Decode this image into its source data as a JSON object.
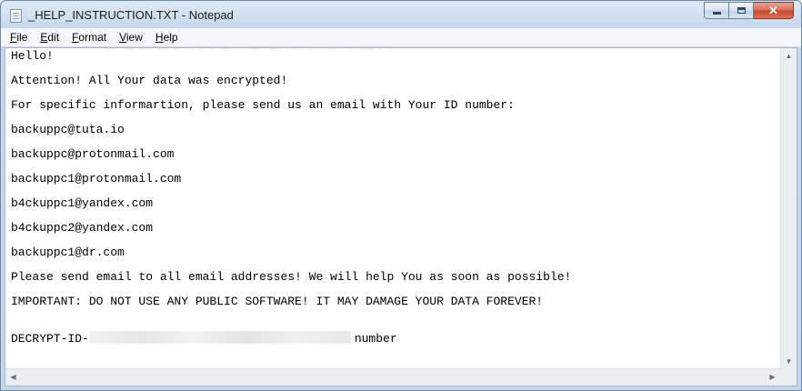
{
  "window": {
    "title": "_HELP_INSTRUCTION.TXT - Notepad",
    "close_glyph": "✕"
  },
  "menu": [
    {
      "accel": "F",
      "rest": "ile"
    },
    {
      "accel": "E",
      "rest": "dit"
    },
    {
      "accel": "F",
      "rest": "ormat"
    },
    {
      "accel": "V",
      "rest": "iew"
    },
    {
      "accel": "H",
      "rest": "elp"
    }
  ],
  "document": {
    "lines": [
      "Hello!",
      "Attention! All Your data was encrypted!",
      "For specific informartion, please send us an email with Your ID number:",
      "backuppc@tuta.io",
      "backuppc@protonmail.com",
      "backuppc1@protonmail.com",
      "b4ckuppc1@yandex.com",
      "b4ckuppc2@yandex.com",
      "backuppc1@dr.com",
      "Please send email to all email addresses! We will help You as soon as possible!",
      "IMPORTANT: DO NOT USE ANY PUBLIC SOFTWARE! IT MAY DAMAGE YOUR DATA FOREVER!"
    ],
    "decrypt_prefix": "DECRYPT-ID-",
    "decrypt_suffix": "number"
  },
  "watermark": "BLEEPING COMPUTER",
  "icons": {
    "app": "notepad-icon",
    "minimize": "minimize-icon",
    "maximize": "maximize-icon",
    "close": "close-icon",
    "scroll_up": "▲",
    "scroll_down": "▼",
    "scroll_left": "◀",
    "scroll_right": "▶"
  },
  "colors": {
    "title_bar": "#c7d8ec",
    "close_button": "#c6442a"
  }
}
